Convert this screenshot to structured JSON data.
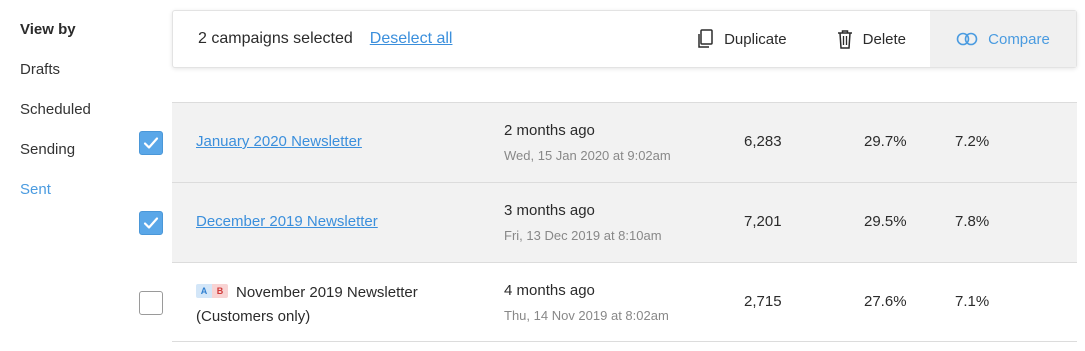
{
  "sidebar": {
    "heading": "View by",
    "items": [
      {
        "label": "Drafts"
      },
      {
        "label": "Scheduled"
      },
      {
        "label": "Sending"
      },
      {
        "label": "Sent"
      }
    ]
  },
  "toolbar": {
    "selected_text": "2 campaigns selected",
    "deselect_label": "Deselect all",
    "duplicate_label": "Duplicate",
    "delete_label": "Delete",
    "compare_label": "Compare"
  },
  "campaigns": [
    {
      "name": "January 2020 Newsletter",
      "checked": true,
      "sent_relative": "2 months ago",
      "sent_date": "Wed, 15 Jan 2020 at 9:02am",
      "recipients": "6,283",
      "open_rate": "29.7%",
      "click_rate": "7.2%"
    },
    {
      "name": "December 2019 Newsletter",
      "checked": true,
      "sent_relative": "3 months ago",
      "sent_date": "Fri, 13 Dec 2019 at 8:10am",
      "recipients": "7,201",
      "open_rate": "29.5%",
      "click_rate": "7.8%"
    },
    {
      "name_line1": "November 2019 Newsletter",
      "name_line2": "(Customers only)",
      "checked": false,
      "ab_test": {
        "a": "A",
        "b": "B"
      },
      "sent_relative": "4 months ago",
      "sent_date": "Thu, 14 Nov 2019 at 8:02am",
      "recipients": "2,715",
      "open_rate": "27.6%",
      "click_rate": "7.1%"
    }
  ],
  "colors": {
    "accent": "#4a9be0",
    "link": "#3b8fdc",
    "selected_row": "#f2f2f2",
    "checkbox_checked": "#5aa7e8"
  }
}
